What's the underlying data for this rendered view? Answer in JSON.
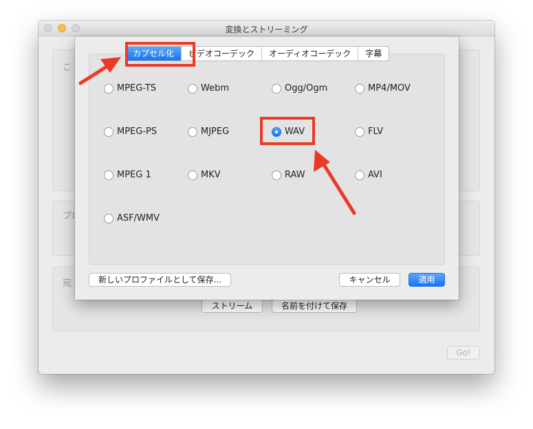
{
  "window": {
    "title": "変換とストリーミング"
  },
  "background": {
    "section1_label": "こ",
    "section2_label": "プロ",
    "section3_label": "宛",
    "stream_button": "ストリーム",
    "save_as_button": "名前を付けて保存",
    "go_button": "Go!"
  },
  "dialog": {
    "tabs": [
      "カプセル化",
      "ビデオコーデック",
      "オーディオコーデック",
      "字幕"
    ],
    "active_tab": "カプセル化",
    "options": [
      "MPEG-TS",
      "Webm",
      "Ogg/Ogm",
      "MP4/MOV",
      "MPEG-PS",
      "MJPEG",
      "WAV",
      "FLV",
      "MPEG 1",
      "MKV",
      "RAW",
      "AVI",
      "ASF/WMV"
    ],
    "selected": "WAV",
    "save_profile_button": "新しいプロファイルとして保存...",
    "cancel_button": "キャンセル",
    "apply_button": "適用"
  },
  "colors": {
    "accent": "#1a73f0",
    "annotation": "#ea3a26"
  }
}
